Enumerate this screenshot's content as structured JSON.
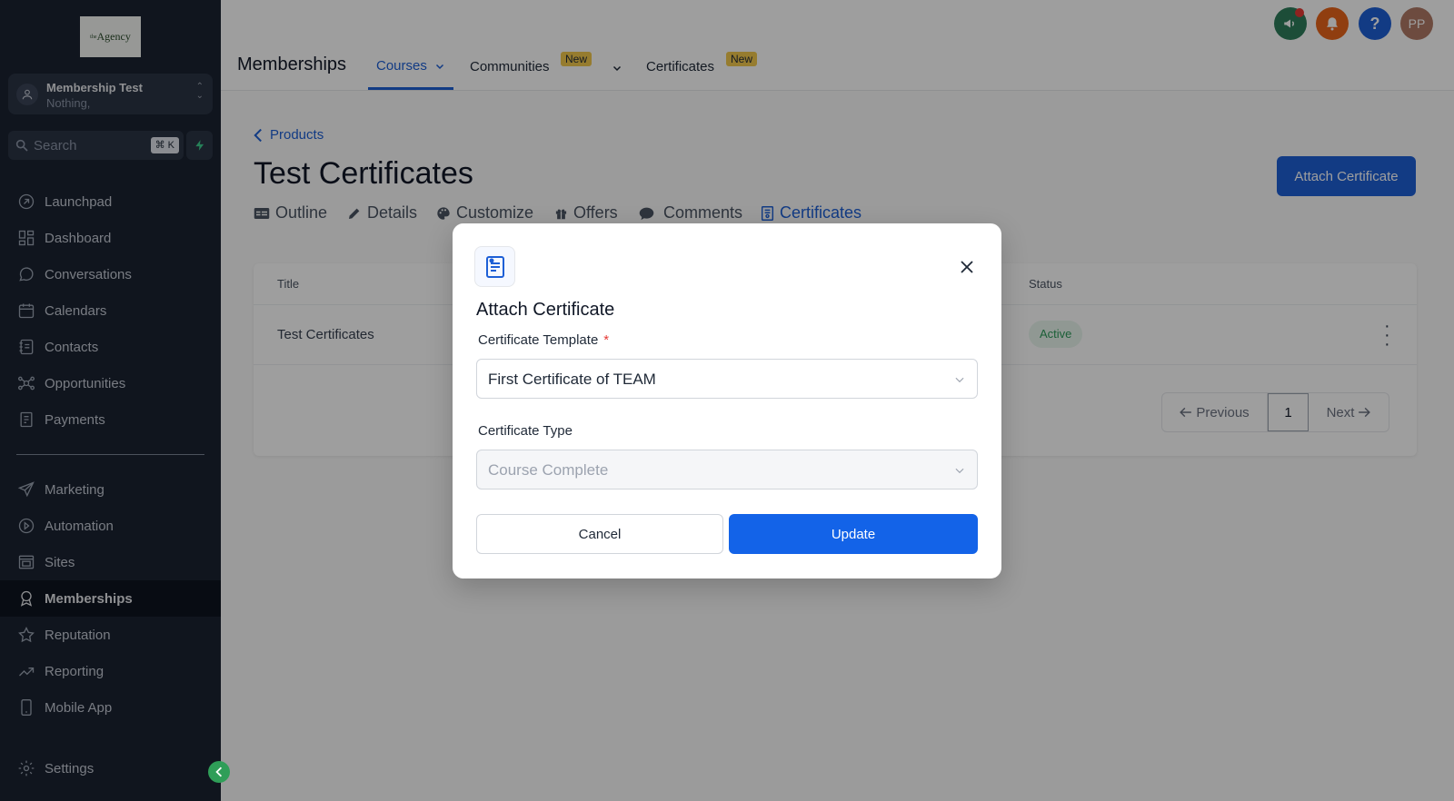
{
  "sidebar": {
    "logo_sup": "the",
    "logo_text": "Agency",
    "account_name": "Membership Test",
    "account_sub": "Nothing,",
    "search_placeholder": "Search",
    "search_shortcut": "⌘ K",
    "items": [
      {
        "label": "Launchpad",
        "icon": "rocket-icon"
      },
      {
        "label": "Dashboard",
        "icon": "grid-icon"
      },
      {
        "label": "Conversations",
        "icon": "chat-icon"
      },
      {
        "label": "Calendars",
        "icon": "calendar-icon"
      },
      {
        "label": "Contacts",
        "icon": "contacts-icon"
      },
      {
        "label": "Opportunities",
        "icon": "opportunities-icon"
      },
      {
        "label": "Payments",
        "icon": "receipt-icon"
      },
      {
        "label": "Marketing",
        "icon": "send-icon"
      },
      {
        "label": "Automation",
        "icon": "automation-icon"
      },
      {
        "label": "Sites",
        "icon": "sites-icon"
      },
      {
        "label": "Memberships",
        "icon": "badge-icon"
      },
      {
        "label": "Reputation",
        "icon": "star-icon"
      },
      {
        "label": "Reporting",
        "icon": "trend-icon"
      },
      {
        "label": "Mobile App",
        "icon": "phone-icon"
      },
      {
        "label": "Settings",
        "icon": "gear-icon"
      }
    ]
  },
  "topbar": {
    "title": "Memberships",
    "tabs": {
      "courses": "Courses",
      "communities": "Communities",
      "certificates": "Certificates"
    },
    "new_badge": "New",
    "user_initials": "PP",
    "help_label": "?"
  },
  "page": {
    "back_label": "Products",
    "title": "Test Certificates",
    "attach_button": "Attach Certificate",
    "tabs": {
      "outline": "Outline",
      "details": "Details",
      "customize": "Customize",
      "offers": "Offers",
      "comments": "Comments",
      "certificates": "Certificates"
    },
    "table": {
      "col_title": "Title",
      "col_status": "Status",
      "row_title": "Test Certificates",
      "row_status": "Active"
    },
    "pager": {
      "previous": "Previous",
      "page": "1",
      "next": "Next"
    }
  },
  "modal": {
    "title": "Attach Certificate",
    "template_label": "Certificate Template",
    "required_mark": "*",
    "template_value": "First Certificate of TEAM",
    "type_label": "Certificate Type",
    "type_value": "Course Complete",
    "cancel_label": "Cancel",
    "update_label": "Update"
  },
  "colors": {
    "sidebar_bg": "#1a2231",
    "accent_blue": "#1d5fd6",
    "update_blue": "#1363e8",
    "badge_yellow": "#f2c94c",
    "status_green": "#2c9a5a"
  }
}
